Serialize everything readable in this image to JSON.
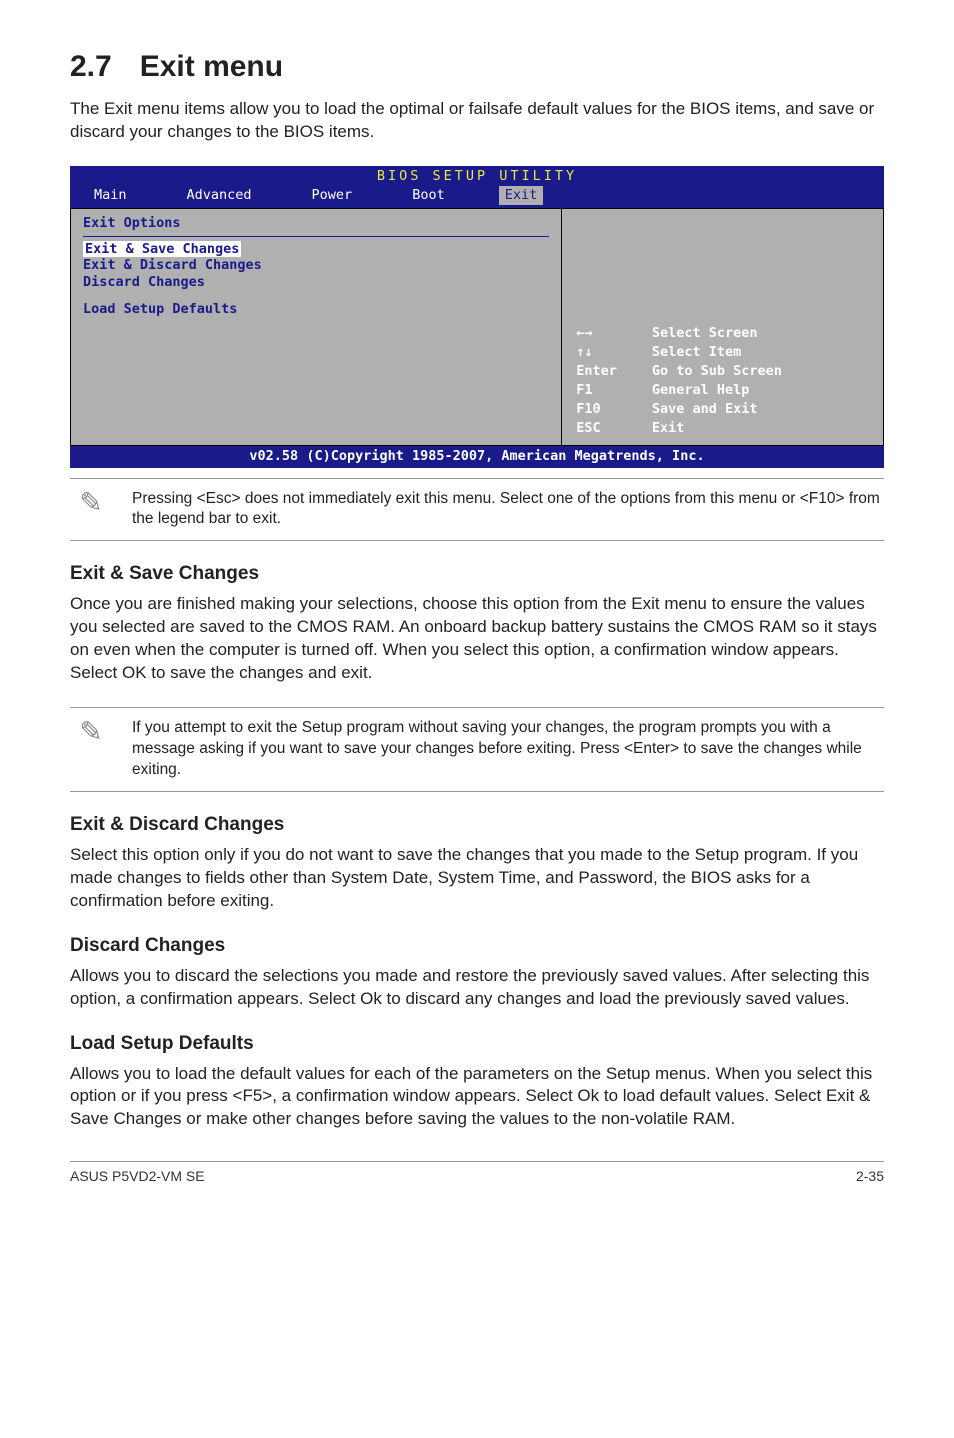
{
  "section": {
    "number": "2.7",
    "title": "Exit menu"
  },
  "intro": "The Exit menu items allow you to load the optimal or failsafe default values for the BIOS items, and save or discard your changes to the BIOS items.",
  "bios": {
    "utility_title": "BIOS SETUP UTILITY",
    "tabs": [
      "Main",
      "Advanced",
      "Power",
      "Boot",
      "Exit"
    ],
    "active_tab": "Exit",
    "left_header": "Exit Options",
    "options": [
      "Exit & Save Changes",
      "Exit & Discard Changes",
      "Discard Changes"
    ],
    "options2": [
      "Load Setup Defaults"
    ],
    "help": [
      {
        "k": "←→",
        "v": "Select Screen"
      },
      {
        "k": "↑↓",
        "v": "Select Item"
      },
      {
        "k": "Enter",
        "v": "Go to Sub Screen"
      },
      {
        "k": "F1",
        "v": "General Help"
      },
      {
        "k": "F10",
        "v": "Save and Exit"
      },
      {
        "k": "ESC",
        "v": "Exit"
      }
    ],
    "footer": "v02.58 (C)Copyright 1985-2007, American Megatrends, Inc."
  },
  "note1": "Pressing <Esc> does not immediately exit this menu. Select one of the options from this menu or <F10> from the legend bar to exit.",
  "s1": {
    "h": "Exit & Save Changes",
    "p": "Once you are finished making your selections, choose this option from the Exit menu to ensure the values you selected are saved to the CMOS RAM. An onboard backup battery sustains the CMOS RAM so it stays on even when the computer is turned off. When you select this option, a confirmation window appears. Select OK to save the changes and exit."
  },
  "note2": " If you attempt to exit the Setup program without saving your changes, the program prompts you with a message asking if you want to save your changes before exiting. Press <Enter>  to save the  changes while exiting.",
  "s2": {
    "h": "Exit & Discard Changes",
    "p": "Select this option only if you do not want to save the changes that you  made to the Setup program. If you made changes to fields other than System Date, System Time, and Password, the BIOS asks for a confirmation before exiting."
  },
  "s3": {
    "h": "Discard Changes",
    "p": "Allows you to discard the selections you made and restore the previously saved values. After selecting this option, a confirmation appears. Select Ok to discard any changes and load the previously saved values."
  },
  "s4": {
    "h": "Load Setup Defaults",
    "p": "Allows you to load the default values for each of the parameters on the Setup menus. When you select this option or if you press <F5>, a confirmation window appears. Select Ok  to load default values. Select Exit & Save Changes or make other changes before saving the values to the non-volatile RAM."
  },
  "footer": {
    "left": "ASUS P5VD2-VM SE",
    "right": "2-35"
  },
  "icons": {
    "pencil": "✎"
  }
}
